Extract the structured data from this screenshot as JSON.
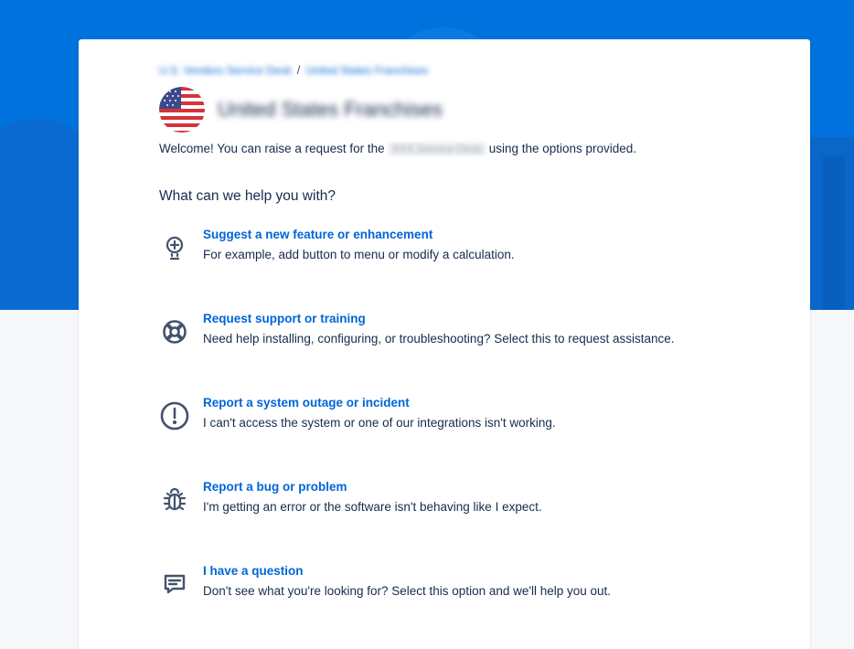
{
  "breadcrumb": {
    "root": "U.S. Vendors Service Desk",
    "separator": "/",
    "current": "United States Franchises"
  },
  "portal": {
    "title": "United States Franchises",
    "icon": "us-flag-icon"
  },
  "welcome": {
    "prefix": "Welcome! You can raise a request for the",
    "redacted": "XXX Service Desk",
    "suffix": "using the options provided."
  },
  "help_title": "What can we help you with?",
  "options": [
    {
      "title": "Suggest a new feature or enhancement",
      "desc": "For example, add button to menu or modify a calculation.",
      "icon": "lightbulb-icon"
    },
    {
      "title": "Request support or training",
      "desc": "Need help installing, configuring, or troubleshooting? Select this to request assistance.",
      "icon": "lifebuoy-icon"
    },
    {
      "title": "Report a system outage or incident",
      "desc": "I can't access the system or one of our integrations isn't working.",
      "icon": "alert-circle-icon"
    },
    {
      "title": "Report a bug or problem",
      "desc": "I'm getting an error or the software isn't behaving like I expect.",
      "icon": "bug-icon"
    },
    {
      "title": "I have a question",
      "desc": "Don't see what you're looking for? Select this option and we'll help you out.",
      "icon": "chat-icon"
    }
  ],
  "colors": {
    "banner": "#0072dd",
    "link": "#0065d8",
    "text": "#172b4d",
    "icon": "#42526e"
  }
}
